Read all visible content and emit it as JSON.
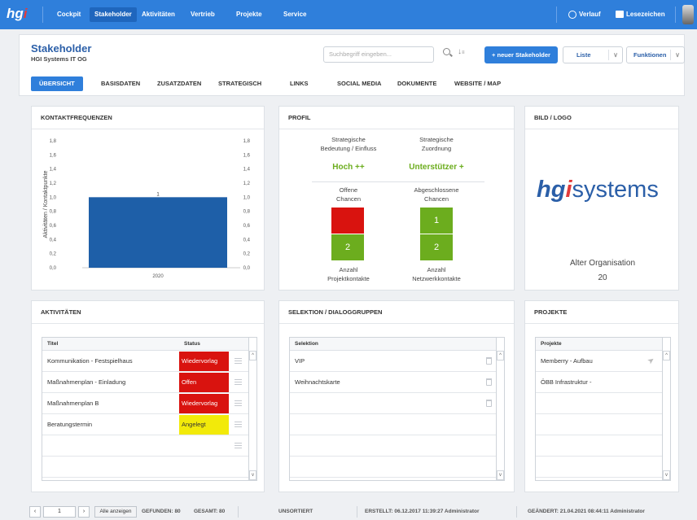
{
  "topbar": {
    "logo_text": "hg",
    "logo_i": "i",
    "nav": [
      "Cockpit",
      "Stakeholder",
      "Aktivitäten",
      "Vertrieb",
      "Projekte",
      "Service"
    ],
    "active_nav": "Stakeholder",
    "verlauf": "Verlauf",
    "lesezeichen": "Lesezeichen",
    "brand_color": "#2f7fdb"
  },
  "header": {
    "title": "Stakeholder",
    "subtitle": "HGI Systems IT OG",
    "search_placeholder": "Suchbegriff eingeben...",
    "new_button": "+ neuer Stakeholder",
    "list_button": "Liste",
    "functions_button": "Funktionen",
    "tabs": [
      "ÜBERSICHT",
      "BASISDATEN",
      "ZUSATZDATEN",
      "STRATEGISCH",
      "LINKS",
      "SOCIAL MEDIA",
      "DOKUMENTE",
      "WEBSITE / MAP"
    ],
    "active_tab": "ÜBERSICHT"
  },
  "kontakt": {
    "title": "KONTAKTFREQUENZEN",
    "chart_data": {
      "type": "bar",
      "categories": [
        "2020"
      ],
      "values": [
        1
      ],
      "data_labels": [
        "1"
      ],
      "ylabel": "Aktivitäten / Kontaktpunkte",
      "ylim": [
        0,
        1.6
      ],
      "yticks": [
        "0,0",
        "0,2",
        "0,4",
        "0,6",
        "0,8",
        "1,0",
        "1,2",
        "1,4",
        "1,6",
        "1,8"
      ],
      "bar_color": "#1e5fa8"
    }
  },
  "profil": {
    "title": "PROFIL",
    "col1_label_1": "Strategische",
    "col1_label_2": "Bedeutung / Einfluss",
    "col1_value": "Hoch ++",
    "col2_label_1": "Strategische",
    "col2_label_2": "Zuordnung",
    "col2_value": "Unterstützer +",
    "offene_1": "Offene",
    "offene_2": "Chancen",
    "abgeschl_1": "Abgeschlossene",
    "abgeschl_2": "Chancen",
    "offene_value": "",
    "abgeschl_value": "1",
    "projektkontakte_value": "2",
    "netzwerk_value": "2",
    "anzahl_1": "Anzahl",
    "projektkontakte": "Projektkontakte",
    "anzahl_2": "Anzahl",
    "netzwerkkontakte": "Netzwerkkontakte",
    "red": "#d9130f",
    "green": "#6cad1e"
  },
  "bild": {
    "title": "BILD / LOGO",
    "logo_hg": "hg",
    "logo_i": "i",
    "logo_systems": "systems",
    "alter_label": "Alter Organisation",
    "alter_value": "20"
  },
  "aktivitaeten": {
    "title": "AKTIVITÄTEN",
    "col_title": "Titel",
    "col_status": "Status",
    "rows": [
      {
        "title": "Kommunikation - Festspielhaus",
        "status": "Wiedervorlag",
        "color": "#d9130f"
      },
      {
        "title": "Maßnahmenplan - Einladung",
        "status": "Offen",
        "color": "#d9130f"
      },
      {
        "title": "Maßnahmenplan B",
        "status": "Wiedervorlag",
        "color": "#d9130f"
      },
      {
        "title": "Beratungstermin",
        "status": "Angelegt",
        "color": "#f2ea0a"
      }
    ]
  },
  "selektion": {
    "title": "SELEKTION / DIALOGGRUPPEN",
    "col": "Selektion",
    "rows": [
      "VIP",
      "Weihnachtskarte"
    ]
  },
  "projekte": {
    "title": "PROJEKTE",
    "col": "Projekte",
    "rows": [
      "Memberry - Aufbau",
      "ÖBB Infrastruktur -"
    ]
  },
  "footer": {
    "prev": "‹",
    "page": "1",
    "next": "›",
    "show_all": "Alle anzeigen",
    "gefunden": "GEFUNDEN: 80",
    "gesamt": "GESAMT: 80",
    "sort": "UNSORTIERT",
    "erstellt": "ERSTELLT:  06.12.2017 11:39:27   Administrator",
    "geaendert": "GEÄNDERT:  21.04.2021 08:44:11   Administrator"
  }
}
